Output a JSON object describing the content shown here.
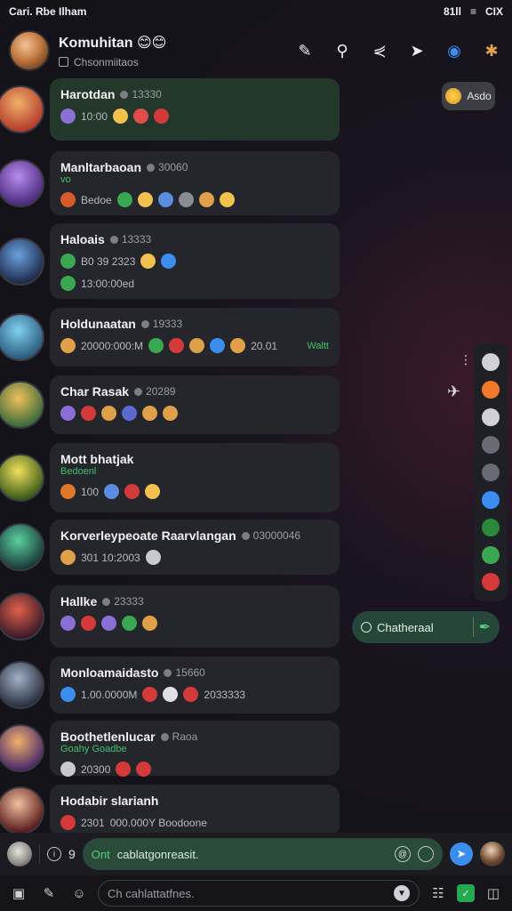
{
  "status_bar": {
    "left": "Cari. Rbe Ilham",
    "signal": "81ll",
    "wifi": "≡",
    "battery": "CIX"
  },
  "header": {
    "title": "Komuhitan 😊😊",
    "subtitle": "Chsonmiitaos",
    "actions": [
      "edit-icon",
      "search-icon",
      "share-icon",
      "forward-icon",
      "bot-icon",
      "star-icon"
    ]
  },
  "pill_top": {
    "label": "Asdo"
  },
  "chats": [
    {
      "name": "Harotdan",
      "meta": "13330",
      "line": "10:00",
      "active": true,
      "colors": [
        "#8a6fd6",
        "#f2c14e",
        "#e04b4b",
        "#d43a3a"
      ],
      "avatar": [
        "#f0b06a",
        "#b33a2a"
      ]
    },
    {
      "name": "Manltarbaoan",
      "meta": "30060",
      "tag": "vo",
      "line": "Bedoe",
      "active": false,
      "colors": [
        "#d65a2a",
        "#3aa852",
        "#f2c14e",
        "#5a8de0",
        "#8c8c96",
        "#e0a04a",
        "#f2c14e"
      ],
      "avatar": [
        "#b88af0",
        "#4a2a7a"
      ]
    },
    {
      "name": "Haloais",
      "meta": "13333",
      "line": "B0   39 2323",
      "line2": "13:00:00ed",
      "active": false,
      "colors": [
        "#3aa852",
        "#f2c14e",
        "#3b8df0"
      ],
      "avatar": [
        "#6aa0e0",
        "#1e2a4a"
      ]
    },
    {
      "name": "Holdunaatan",
      "meta": "19333",
      "line": "20000:000:M",
      "line_b": "20.01",
      "tag_right": "Waltt",
      "active": false,
      "colors": [
        "#e0a04a",
        "#3aa852",
        "#d43a3a",
        "#e0a04a",
        "#3b8df0",
        "#e0a04a"
      ],
      "avatar": [
        "#7fd0f0",
        "#2a5a7a"
      ]
    },
    {
      "name": "Char Rasak",
      "meta": "20289",
      "line": "",
      "active": false,
      "colors": [
        "#8a6fd6",
        "#d43a3a",
        "#e0a04a",
        "#5a6ad0",
        "#e0a04a",
        "#e0a04a"
      ],
      "avatar": [
        "#f0c05a",
        "#3a6a3a"
      ]
    },
    {
      "name": "Mott bhatjak",
      "meta": "",
      "tag": "Bedoenl",
      "line": "100",
      "active": false,
      "colors": [
        "#e0762a",
        "#5a8de0",
        "#d43a3a",
        "#f2c14e"
      ],
      "avatar": [
        "#f0e05a",
        "#3a5a1a"
      ]
    },
    {
      "name": "Korverleypeoate Raarvlangan",
      "meta": "03000046",
      "line": "301   10:2003",
      "active": false,
      "colors": [
        "#e0a04a",
        "#c8c8cf"
      ],
      "avatar": [
        "#5ad0a0",
        "#1a3a3a"
      ]
    },
    {
      "name": "Hallke",
      "meta": "23333",
      "line": "",
      "active": false,
      "colors": [
        "#8a6fd6",
        "#d43a3a",
        "#8a6fd6",
        "#3aa852",
        "#e0a04a"
      ],
      "avatar": [
        "#e0604a",
        "#3a1a2a"
      ]
    },
    {
      "name": "Monloamaidasto",
      "meta": "15660",
      "line": "1.00.0000M",
      "line_b": "2033333",
      "active": false,
      "colors": [
        "#3b8df0",
        "#d43a3a",
        "#e0e0e6",
        "#d43a3a"
      ],
      "avatar": [
        "#a0b0c8",
        "#2a3040"
      ]
    },
    {
      "name": "Boothetlenlucar",
      "meta": "Raoa",
      "tag": "Goahy Goadbe",
      "line": "20300",
      "active": false,
      "colors": [
        "#c8c8cf",
        "#d43a3a",
        "#d43a3a"
      ],
      "avatar": [
        "#f0b06a",
        "#4a2a6a"
      ]
    },
    {
      "name": "Hodabir slarianh",
      "meta": "",
      "line": "2301",
      "line_b": "000.000Y   Boodoone",
      "active": false,
      "colors": [
        "#d43a3a"
      ],
      "avatar": [
        "#f0c0a0",
        "#5a1a1a"
      ]
    }
  ],
  "side_rail": {
    "icons": [
      "clock-icon",
      "orange-badge-icon",
      "group-icon",
      "video-icon",
      "tv-icon",
      "blue-badge-icon",
      "green-square-icon",
      "green-circle-icon",
      "heart-icon"
    ]
  },
  "channel_pill": {
    "label": "Chatheraal"
  },
  "compose": {
    "num": "9",
    "placeholder_green": "Ont",
    "placeholder": "cablatgonreasit."
  },
  "bottom_nav": {
    "search_placeholder": "Ch  cahlattatfnes."
  }
}
